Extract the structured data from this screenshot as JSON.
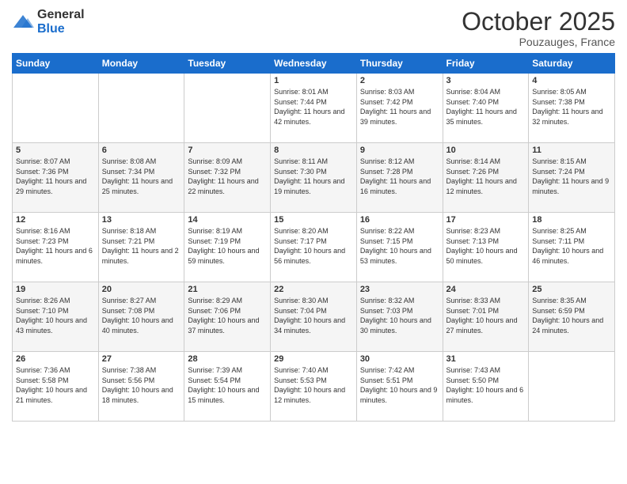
{
  "header": {
    "logo": {
      "general": "General",
      "blue": "Blue"
    },
    "title": "October 2025",
    "subtitle": "Pouzauges, France"
  },
  "weekdays": [
    "Sunday",
    "Monday",
    "Tuesday",
    "Wednesday",
    "Thursday",
    "Friday",
    "Saturday"
  ],
  "weeks": [
    [
      {
        "day": "",
        "sunrise": "",
        "sunset": "",
        "daylight": ""
      },
      {
        "day": "",
        "sunrise": "",
        "sunset": "",
        "daylight": ""
      },
      {
        "day": "",
        "sunrise": "",
        "sunset": "",
        "daylight": ""
      },
      {
        "day": "1",
        "sunrise": "Sunrise: 8:01 AM",
        "sunset": "Sunset: 7:44 PM",
        "daylight": "Daylight: 11 hours and 42 minutes."
      },
      {
        "day": "2",
        "sunrise": "Sunrise: 8:03 AM",
        "sunset": "Sunset: 7:42 PM",
        "daylight": "Daylight: 11 hours and 39 minutes."
      },
      {
        "day": "3",
        "sunrise": "Sunrise: 8:04 AM",
        "sunset": "Sunset: 7:40 PM",
        "daylight": "Daylight: 11 hours and 35 minutes."
      },
      {
        "day": "4",
        "sunrise": "Sunrise: 8:05 AM",
        "sunset": "Sunset: 7:38 PM",
        "daylight": "Daylight: 11 hours and 32 minutes."
      }
    ],
    [
      {
        "day": "5",
        "sunrise": "Sunrise: 8:07 AM",
        "sunset": "Sunset: 7:36 PM",
        "daylight": "Daylight: 11 hours and 29 minutes."
      },
      {
        "day": "6",
        "sunrise": "Sunrise: 8:08 AM",
        "sunset": "Sunset: 7:34 PM",
        "daylight": "Daylight: 11 hours and 25 minutes."
      },
      {
        "day": "7",
        "sunrise": "Sunrise: 8:09 AM",
        "sunset": "Sunset: 7:32 PM",
        "daylight": "Daylight: 11 hours and 22 minutes."
      },
      {
        "day": "8",
        "sunrise": "Sunrise: 8:11 AM",
        "sunset": "Sunset: 7:30 PM",
        "daylight": "Daylight: 11 hours and 19 minutes."
      },
      {
        "day": "9",
        "sunrise": "Sunrise: 8:12 AM",
        "sunset": "Sunset: 7:28 PM",
        "daylight": "Daylight: 11 hours and 16 minutes."
      },
      {
        "day": "10",
        "sunrise": "Sunrise: 8:14 AM",
        "sunset": "Sunset: 7:26 PM",
        "daylight": "Daylight: 11 hours and 12 minutes."
      },
      {
        "day": "11",
        "sunrise": "Sunrise: 8:15 AM",
        "sunset": "Sunset: 7:24 PM",
        "daylight": "Daylight: 11 hours and 9 minutes."
      }
    ],
    [
      {
        "day": "12",
        "sunrise": "Sunrise: 8:16 AM",
        "sunset": "Sunset: 7:23 PM",
        "daylight": "Daylight: 11 hours and 6 minutes."
      },
      {
        "day": "13",
        "sunrise": "Sunrise: 8:18 AM",
        "sunset": "Sunset: 7:21 PM",
        "daylight": "Daylight: 11 hours and 2 minutes."
      },
      {
        "day": "14",
        "sunrise": "Sunrise: 8:19 AM",
        "sunset": "Sunset: 7:19 PM",
        "daylight": "Daylight: 10 hours and 59 minutes."
      },
      {
        "day": "15",
        "sunrise": "Sunrise: 8:20 AM",
        "sunset": "Sunset: 7:17 PM",
        "daylight": "Daylight: 10 hours and 56 minutes."
      },
      {
        "day": "16",
        "sunrise": "Sunrise: 8:22 AM",
        "sunset": "Sunset: 7:15 PM",
        "daylight": "Daylight: 10 hours and 53 minutes."
      },
      {
        "day": "17",
        "sunrise": "Sunrise: 8:23 AM",
        "sunset": "Sunset: 7:13 PM",
        "daylight": "Daylight: 10 hours and 50 minutes."
      },
      {
        "day": "18",
        "sunrise": "Sunrise: 8:25 AM",
        "sunset": "Sunset: 7:11 PM",
        "daylight": "Daylight: 10 hours and 46 minutes."
      }
    ],
    [
      {
        "day": "19",
        "sunrise": "Sunrise: 8:26 AM",
        "sunset": "Sunset: 7:10 PM",
        "daylight": "Daylight: 10 hours and 43 minutes."
      },
      {
        "day": "20",
        "sunrise": "Sunrise: 8:27 AM",
        "sunset": "Sunset: 7:08 PM",
        "daylight": "Daylight: 10 hours and 40 minutes."
      },
      {
        "day": "21",
        "sunrise": "Sunrise: 8:29 AM",
        "sunset": "Sunset: 7:06 PM",
        "daylight": "Daylight: 10 hours and 37 minutes."
      },
      {
        "day": "22",
        "sunrise": "Sunrise: 8:30 AM",
        "sunset": "Sunset: 7:04 PM",
        "daylight": "Daylight: 10 hours and 34 minutes."
      },
      {
        "day": "23",
        "sunrise": "Sunrise: 8:32 AM",
        "sunset": "Sunset: 7:03 PM",
        "daylight": "Daylight: 10 hours and 30 minutes."
      },
      {
        "day": "24",
        "sunrise": "Sunrise: 8:33 AM",
        "sunset": "Sunset: 7:01 PM",
        "daylight": "Daylight: 10 hours and 27 minutes."
      },
      {
        "day": "25",
        "sunrise": "Sunrise: 8:35 AM",
        "sunset": "Sunset: 6:59 PM",
        "daylight": "Daylight: 10 hours and 24 minutes."
      }
    ],
    [
      {
        "day": "26",
        "sunrise": "Sunrise: 7:36 AM",
        "sunset": "Sunset: 5:58 PM",
        "daylight": "Daylight: 10 hours and 21 minutes."
      },
      {
        "day": "27",
        "sunrise": "Sunrise: 7:38 AM",
        "sunset": "Sunset: 5:56 PM",
        "daylight": "Daylight: 10 hours and 18 minutes."
      },
      {
        "day": "28",
        "sunrise": "Sunrise: 7:39 AM",
        "sunset": "Sunset: 5:54 PM",
        "daylight": "Daylight: 10 hours and 15 minutes."
      },
      {
        "day": "29",
        "sunrise": "Sunrise: 7:40 AM",
        "sunset": "Sunset: 5:53 PM",
        "daylight": "Daylight: 10 hours and 12 minutes."
      },
      {
        "day": "30",
        "sunrise": "Sunrise: 7:42 AM",
        "sunset": "Sunset: 5:51 PM",
        "daylight": "Daylight: 10 hours and 9 minutes."
      },
      {
        "day": "31",
        "sunrise": "Sunrise: 7:43 AM",
        "sunset": "Sunset: 5:50 PM",
        "daylight": "Daylight: 10 hours and 6 minutes."
      },
      {
        "day": "",
        "sunrise": "",
        "sunset": "",
        "daylight": ""
      }
    ]
  ]
}
